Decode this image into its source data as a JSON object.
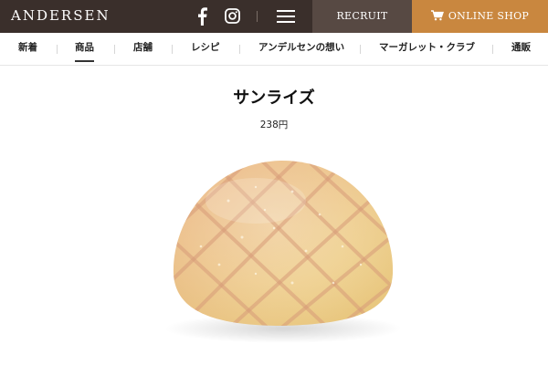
{
  "header": {
    "logo": "ANDERSEN",
    "recruit_label": "RECRUIT",
    "online_shop_label": "ONLINE SHOP"
  },
  "nav": {
    "items": [
      {
        "label": "新着"
      },
      {
        "label": "商品",
        "active": true
      },
      {
        "label": "店舗"
      },
      {
        "label": "レシピ"
      },
      {
        "label": "アンデルセンの想い"
      },
      {
        "label": "マーガレット・クラブ"
      },
      {
        "label": "通販"
      }
    ]
  },
  "product": {
    "name": "サンライズ",
    "price": "238円",
    "image_icon": "melon-bread-image"
  },
  "colors": {
    "topbar": "#3a2f2b",
    "recruit_bg": "#574943",
    "shop_bg": "#c9873f",
    "nav_underline": "#333333"
  }
}
